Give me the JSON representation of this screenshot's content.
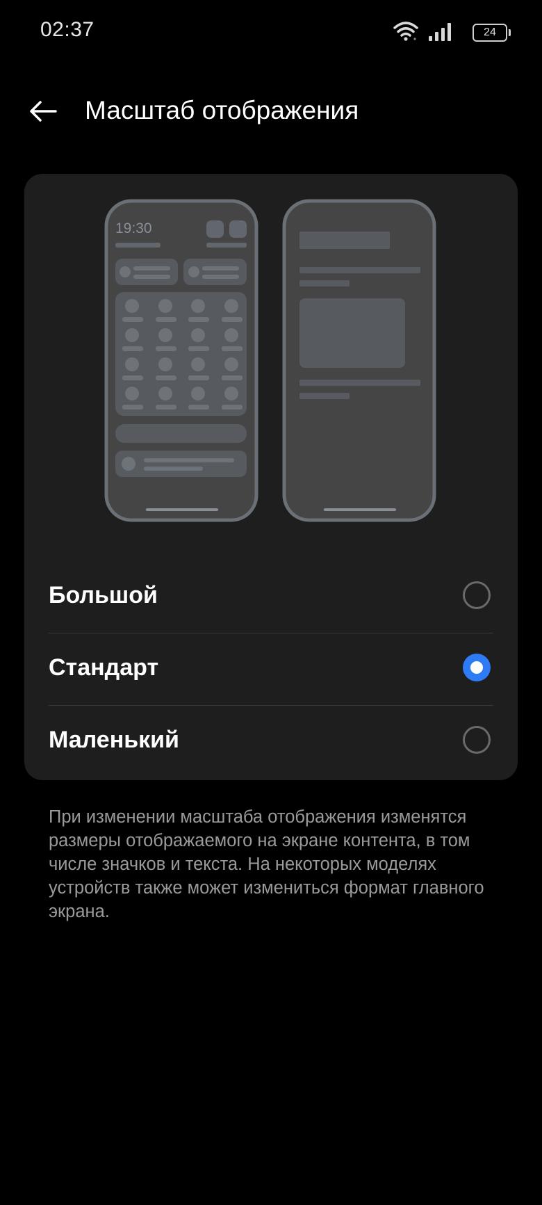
{
  "status_bar": {
    "time": "02:37",
    "battery_level": "24",
    "icons": [
      "wifi-icon",
      "signal-icon",
      "battery-icon"
    ]
  },
  "header": {
    "back_icon": "arrow-left-icon",
    "title": "Масштаб отображения"
  },
  "preview": {
    "clock_text": "19:30"
  },
  "options": [
    {
      "label": "Большой",
      "selected": false
    },
    {
      "label": "Стандарт",
      "selected": true
    },
    {
      "label": "Маленький",
      "selected": false
    }
  ],
  "description": "При изменении масштаба отображения изменятся размеры отображаемого на экране контента, в том числе значков и текста. На некоторых моделях устройств также может измениться формат главного экрана.",
  "colors": {
    "background": "#000000",
    "card": "#1e1e1e",
    "accent": "#2f7af5",
    "secondary_text": "#9a9a9a"
  }
}
